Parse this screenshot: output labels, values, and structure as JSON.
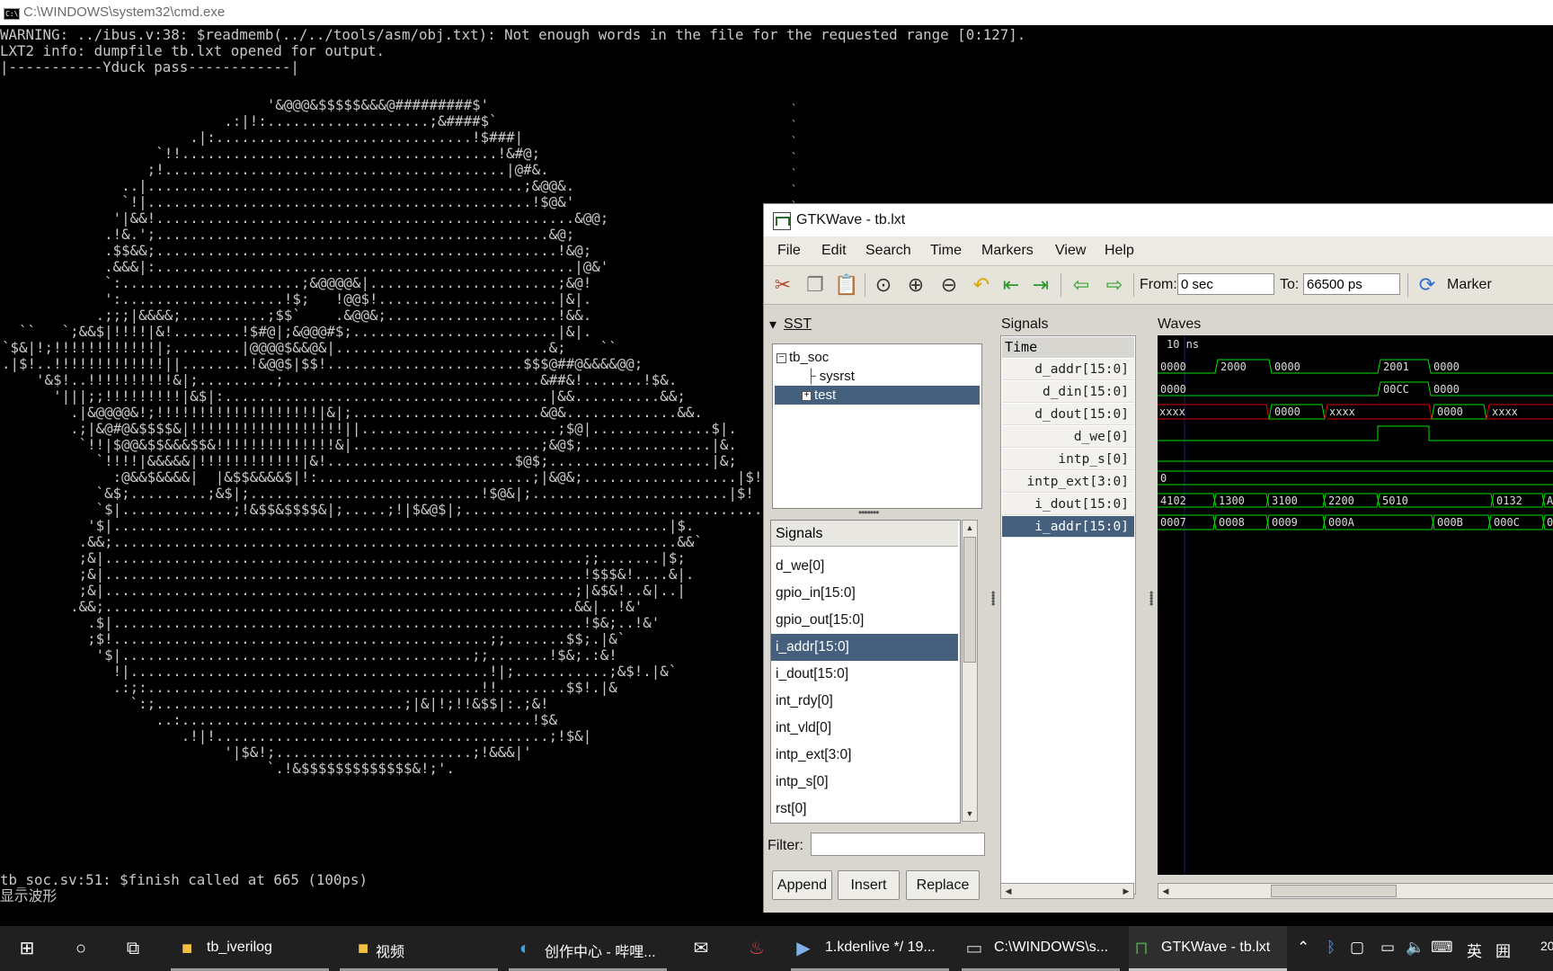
{
  "cmd": {
    "title": "C:\\WINDOWS\\system32\\cmd.exe",
    "head_text": "WARNING: ../ibus.v:38: $readmemb(../../tools/asm/obj.txt): Not enough words in the file for the requested range [0:127].\nLXT2 info: dumpfile tb.lxt opened for output.\n|-----------Yduck pass------------|",
    "ascii_art": "                               '&@@@&$$$$$&&&@#########$'\n                          .:|!:...................;&####$`\n                      .|:..............................!$###|\n                  `!!.....................................!&#@;\n                 ;!........................................|@#&.\n              ..|............................................;&@@&.\n              `!|.............................................!$@&'\n             '|&&!.................................................&@@;\n            .!&.';..............................................&@;\n            .$$&&;...............................................!&@;\n            .&&&|:.................................................|@&'\n            `:.....................;&@@@@&|......................;&@!\n            ':...................!$;   !@@$!.....................|&|.\n           .;;;|&&&&;..........;$$`    .&@@&;....................!&&.\n  ``   `;&&$|!!!!|&!........!$#@|;&@@@#$;........................|&|.\n`$&|!;!!!!!!!!!!!!|;........|@@@@$&&@&|.........................&;    ``\n.|$!..!!!!!!!!!!!!!||........!&@@$|$$!.......................$$$@##@&&&&@@;\n    '&$!..!!!!!!!!!!&|;.........;..............................&##&!.......!$&.\n      '|||;;!!!!!!!!!|&$|:......................................|&&..........&&;\n        .|&@@@@&!;!!!!!!!!!!!!!!!!!!!|&|;......................&@&.............&&.\n        .;|&@#@&$$$$&|!!!!!!!!!!!!!!!!!!||.......................;$@|..............$|.\n         `!!|$@@&$$&&&$$&!!!!!!!!!!!!!!&|......................;&@$;...............|&.\n           `!!!!|&&&&&|!!!!!!!!!!!!|&!......................$@$;...................|&;\n             :@&&$&&&&|  |&$$&&&&$|!:.........................;|&@&;..................|$!\n           `&$;.........;&$|;...........................!$@&|;.......................|$!\n           `$|.............;!&$$&$$$$&|;.....;!|$&@$|;....................................|&!\n          '$|.................................................................|$.\n         .&&;..................................................................&&`\n         ;&|........................................................;;.......|$;\n         ;&|........................................................!$$$&!....&|.\n         ;&|.......................................................;|&$&!..&|..|\n        .&&;.......................................................&&|..!&'\n          .$|.......................................................!$&;..!&'\n          ;$!............................................;;.......$$;.|&`\n           '$|.........................................;;.......!$&;.:&!\n             !|..........................................!|;...........;&$!.|&`\n             .:;:.......................................!!........$$!.|&\n               `:;.............................;|&|!;!!&$$|:.;&!\n                  ..:.........................................!$&\n                     .!|!.......................................;!$&|\n                          '|$&!;.......................;!&&&|'\n                               `.!&$$$$$$$$$$$$$&!;'.",
    "tail_text": "tb_soc.sv:51: $finish called at 665 (100ps)\n显示波形"
  },
  "gtkwave": {
    "title": "GTKWave - tb.lxt",
    "menu": [
      "File",
      "Edit",
      "Search",
      "Time",
      "Markers",
      "View",
      "Help"
    ],
    "toolbar": {
      "from_label": "From:",
      "from_value": "0 sec",
      "to_label": "To:",
      "to_value": "66500 ps",
      "marker_label": "Marker"
    },
    "sst": {
      "label": "SST",
      "tree": [
        {
          "name": "tb_soc",
          "expander": "−"
        },
        {
          "name": "sysrst"
        },
        {
          "name": "test",
          "expander": "+",
          "selected": true
        }
      ]
    },
    "signal_list": {
      "header": "Signals",
      "items": [
        "d_we[0]",
        "gpio_in[15:0]",
        "gpio_out[15:0]",
        "i_addr[15:0]",
        "i_dout[15:0]",
        "int_rdy[0]",
        "int_vld[0]",
        "intp_ext[3:0]",
        "intp_s[0]",
        "rst[0]"
      ],
      "selected": "i_addr[15:0]"
    },
    "filter_label": "Filter:",
    "buttons": {
      "append": "Append",
      "insert": "Insert",
      "replace": "Replace"
    },
    "signals_pane": {
      "label": "Signals",
      "header": "Time",
      "rows": [
        "d_addr[15:0]",
        "d_din[15:0]",
        "d_dout[15:0]",
        "d_we[0]",
        "intp_s[0]",
        "intp_ext[3:0]",
        "i_dout[15:0]",
        "i_addr[15:0]"
      ],
      "selected": "i_addr[15:0]"
    },
    "waves": {
      "label": "Waves",
      "time_label": "10 ns",
      "trace_labels": {
        "d_addr": [
          "0000",
          "2000",
          "0000",
          "2001",
          "0000"
        ],
        "d_din": [
          "0000",
          "00CC",
          "0000"
        ],
        "d_dout": [
          "xxxx",
          "0000",
          "xxxx",
          "0000",
          "xxxx"
        ],
        "intp_ext": [
          "0"
        ],
        "i_dout": [
          "4102",
          "1300",
          "3100",
          "2200",
          "5010",
          "0132",
          "A"
        ],
        "i_addr": [
          "0007",
          "0008",
          "0009",
          "000A",
          "000B",
          "000C",
          "00"
        ]
      },
      "colors": {
        "bus": "#00e000",
        "undefined": "#e00000",
        "cursor": "#1a1a80"
      }
    }
  },
  "taskbar": {
    "items": [
      {
        "label": "tb_iverilog",
        "icon": "folder-icon"
      },
      {
        "label": "视频",
        "icon": "folder-icon"
      },
      {
        "label": "创作中心 - 哔哩...",
        "icon": "edge-icon"
      },
      {
        "label": "",
        "icon": "mail-icon"
      },
      {
        "label": "",
        "icon": "flame-icon"
      },
      {
        "label": "1.kdenlive */ 19...",
        "icon": "kdenlive-icon"
      },
      {
        "label": "C:\\WINDOWS\\s...",
        "icon": "cmd-icon"
      },
      {
        "label": "GTKWave - tb.lxt",
        "icon": "gtkwave-icon"
      }
    ],
    "tray": {
      "ime_lang": "英",
      "clock_partial": "20"
    }
  }
}
